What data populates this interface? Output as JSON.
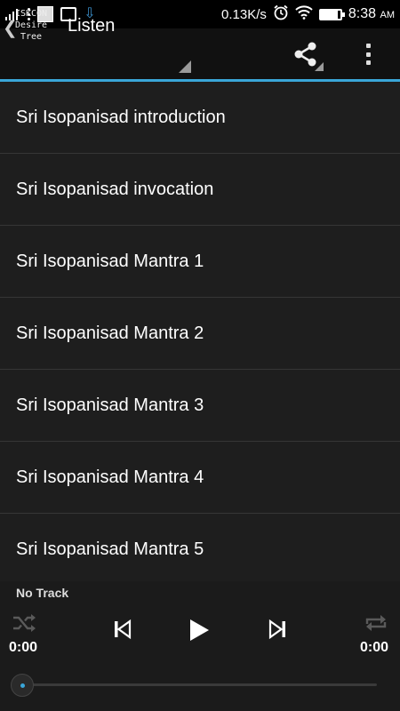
{
  "status_bar": {
    "net_speed": "0.13K/s",
    "time": "8:38",
    "ampm": "AM",
    "battery_level": 0.88,
    "icons": [
      "signal-icon",
      "overflow-dots-icon",
      "newspaper-icon",
      "image-icon",
      "download-icon",
      "alarm-icon",
      "wifi-icon",
      "battery-icon"
    ]
  },
  "action_bar": {
    "brand_lines": [
      "ISKCON",
      "Desire",
      "Tree"
    ],
    "title": "Listen",
    "icons": [
      "back-chevron-icon",
      "share-icon",
      "overflow-menu-icon"
    ]
  },
  "tracks": [
    "Sri Isopanisad introduction",
    "Sri Isopanisad invocation",
    "Sri Isopanisad Mantra 1",
    "Sri Isopanisad Mantra 2",
    "Sri Isopanisad Mantra 3",
    "Sri Isopanisad Mantra 4",
    "Sri Isopanisad Mantra 5"
  ],
  "player": {
    "now_playing": "No Track",
    "elapsed": "0:00",
    "duration": "0:00",
    "progress": 0,
    "controls": [
      "shuffle-icon",
      "previous-icon",
      "play-icon",
      "next-icon",
      "repeat-icon"
    ]
  },
  "colors": {
    "accent": "#3aa6d8",
    "list_bg": "#1e1e1e",
    "divider": "#363636"
  }
}
